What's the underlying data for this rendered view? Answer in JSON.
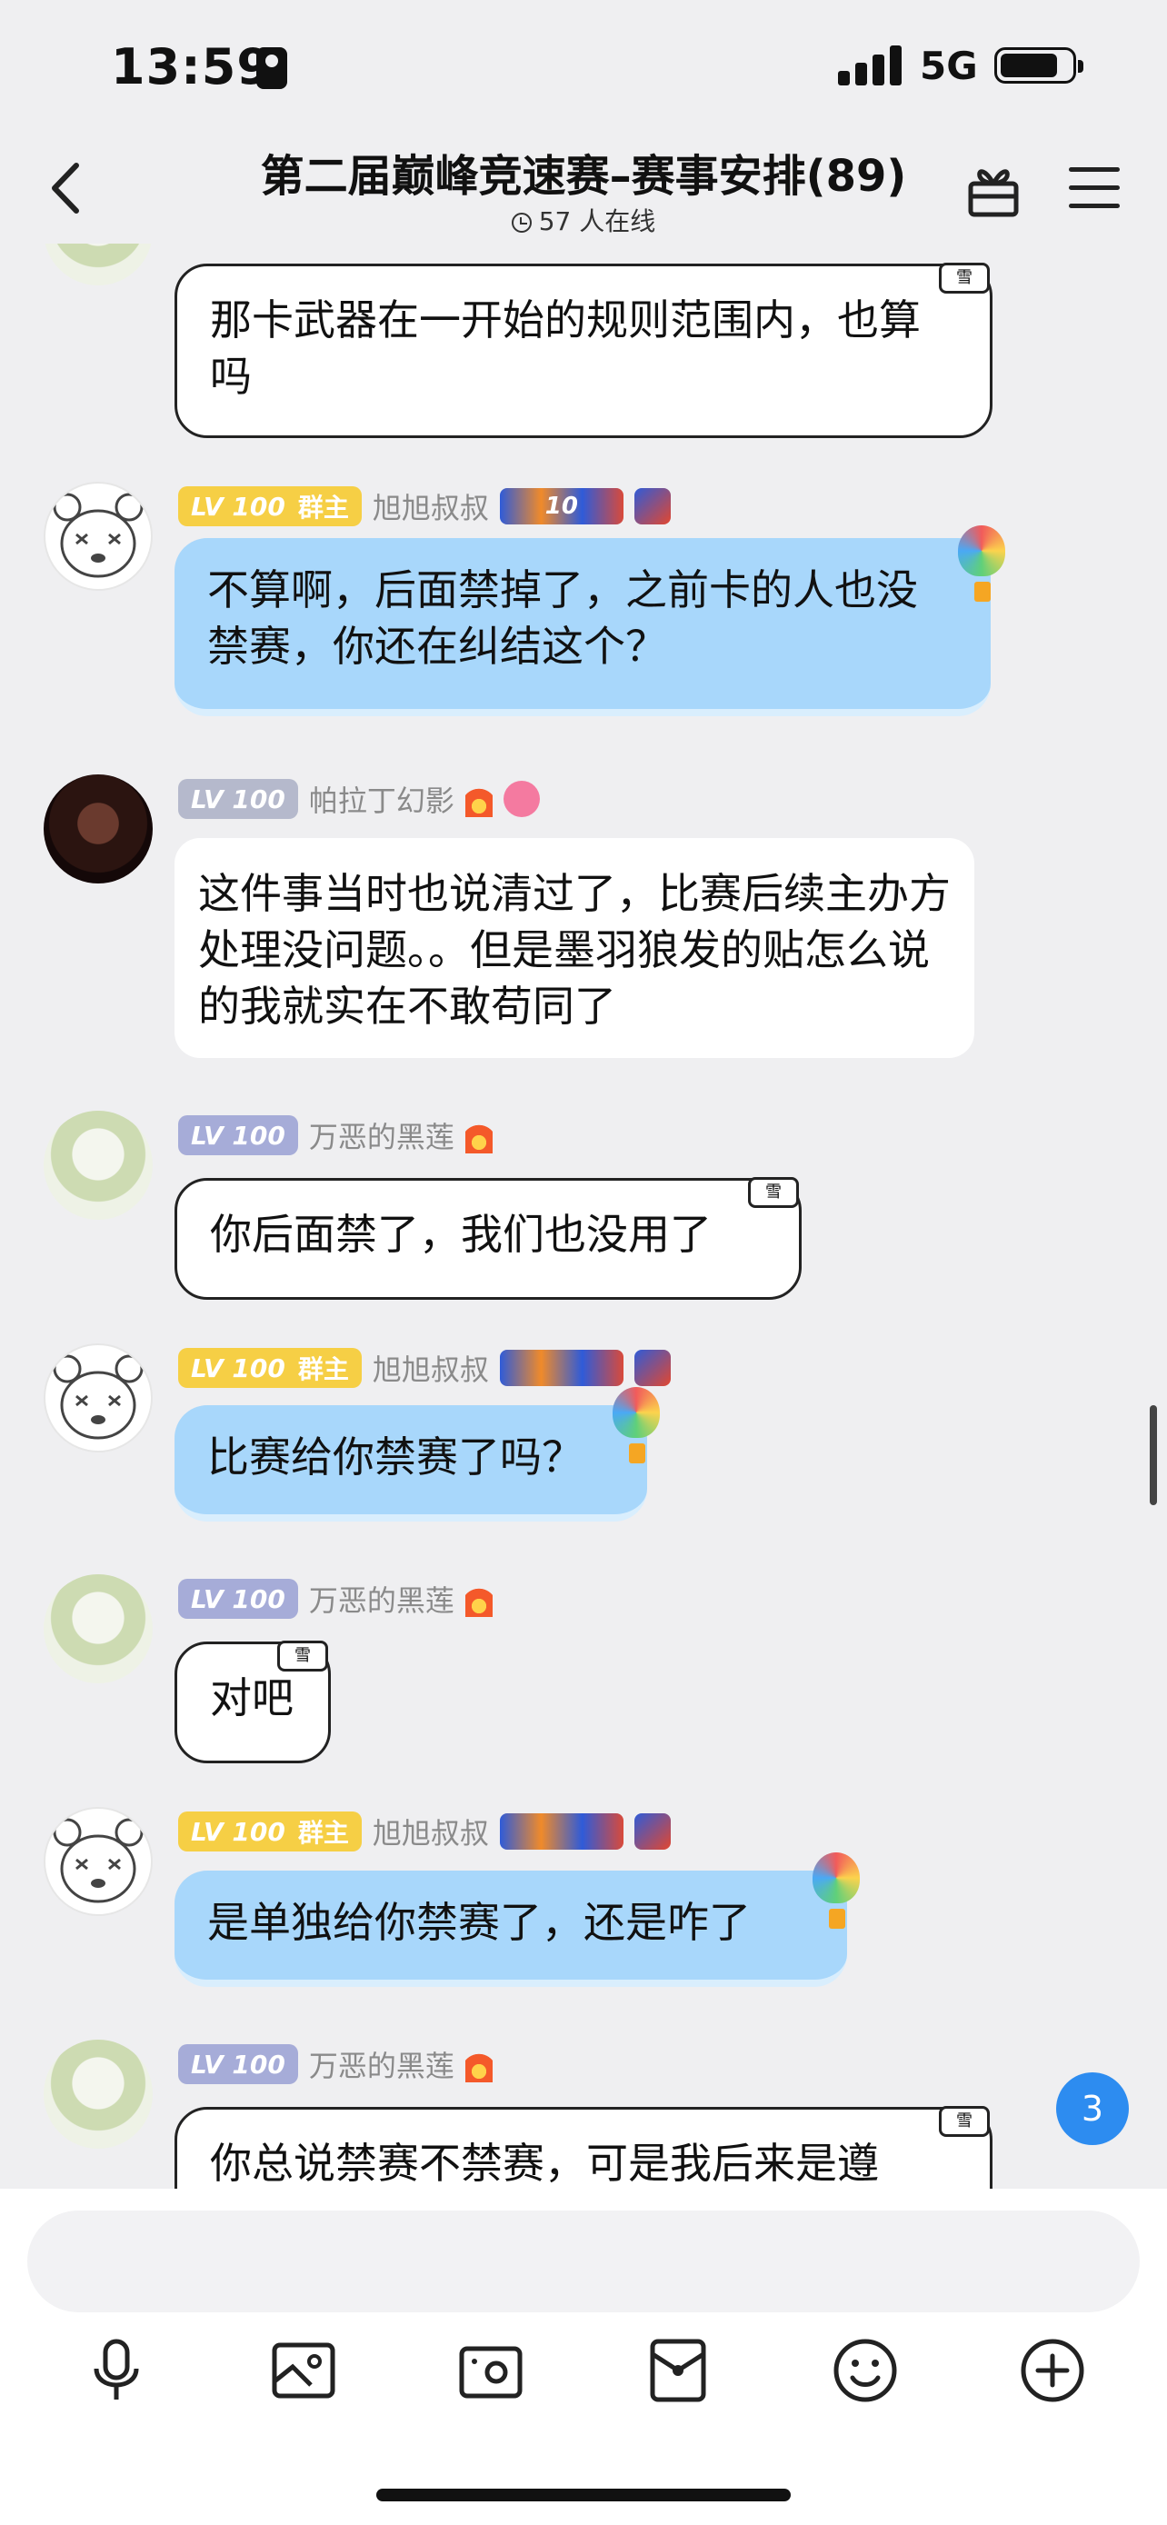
{
  "status_bar": {
    "time": "13:59",
    "network": "5G"
  },
  "header": {
    "title": "第二届巅峰竞速赛–赛事安排(89)",
    "online": "57 人在线"
  },
  "messages": [
    {
      "sender": "",
      "text": "那卡武器在一开始的规则范围内，也算吗",
      "tag": "雪"
    },
    {
      "level": "LV 100",
      "role": "群主",
      "sender": "旭旭叔叔",
      "badge_text": "10",
      "text": "不算啊，后面禁掉了，之前卡的人也没禁赛，你还在纠结这个？"
    },
    {
      "level": "LV 100",
      "sender": "帕拉丁幻影",
      "text": "这件事当时也说清过了，比赛后续主办方处理没问题。。但是墨羽狼发的贴怎么说的我就实在不敢苟同了"
    },
    {
      "level": "LV 100",
      "sender": "万恶的黑莲",
      "text": "你后面禁了，我们也没用了",
      "tag": "雪"
    },
    {
      "level": "LV 100",
      "role": "群主",
      "sender": "旭旭叔叔",
      "text": "比赛给你禁赛了吗？"
    },
    {
      "level": "LV 100",
      "sender": "万恶的黑莲",
      "text": "对吧",
      "tag": "雪"
    },
    {
      "level": "LV 100",
      "role": "群主",
      "sender": "旭旭叔叔",
      "text": "是单独给你禁赛了，还是咋了"
    },
    {
      "level": "LV 100",
      "sender": "万恶的黑莲",
      "text": "你总说禁赛不禁赛，可是我后来是遵",
      "tag": "雪"
    }
  ],
  "unread_count": "3",
  "input": {
    "placeholder": ""
  },
  "toolbar": [
    "microphone-icon",
    "image-icon",
    "camera-icon",
    "red-packet-icon",
    "emoji-icon",
    "plus-icon"
  ]
}
